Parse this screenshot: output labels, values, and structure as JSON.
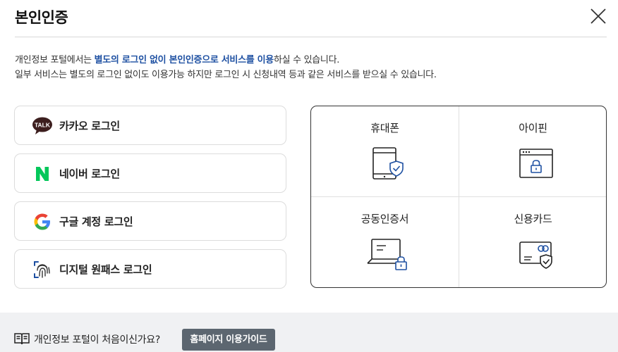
{
  "header": {
    "title": "본인인증"
  },
  "description": {
    "line1_pre": "개인정보 포털에서는 ",
    "line1_highlight": "별도의 로그인 없이 본인인증으로 서비스를 이용",
    "line1_post": "하실 수 있습니다.",
    "line2": "일부 서비스는 별도의 로그인 없이도 이용가능 하지만 로그인 시 신청내역 등과 같은 서비스를 받으실 수 있습니다."
  },
  "logins": [
    {
      "label": "카카오 로그인",
      "icon": "kakao-talk-icon",
      "icon_text": "TALK"
    },
    {
      "label": "네이버 로그인",
      "icon": "naver-icon",
      "icon_text": "N"
    },
    {
      "label": "구글 계정 로그인",
      "icon": "google-icon",
      "icon_text": "G"
    },
    {
      "label": "디지털 원패스 로그인",
      "icon": "fingerprint-icon"
    }
  ],
  "cert_methods": [
    {
      "label": "휴대폰",
      "icon": "phone-shield-icon"
    },
    {
      "label": "아이핀",
      "icon": "browser-lock-icon"
    },
    {
      "label": "공동인증서",
      "icon": "laptop-lock-icon"
    },
    {
      "label": "신용카드",
      "icon": "card-shield-icon"
    }
  ],
  "footer": {
    "text": "개인정보 포털이 처음이신가요?",
    "button": "홈페이지 이용가이드"
  },
  "colors": {
    "highlight": "#1e50a2",
    "kakao_bg": "#3c1e1e",
    "naver_green": "#03c75a",
    "icon_blue": "#1e50a2",
    "guide_button": "#5c6670",
    "footer_bg": "#f0f1f3"
  }
}
